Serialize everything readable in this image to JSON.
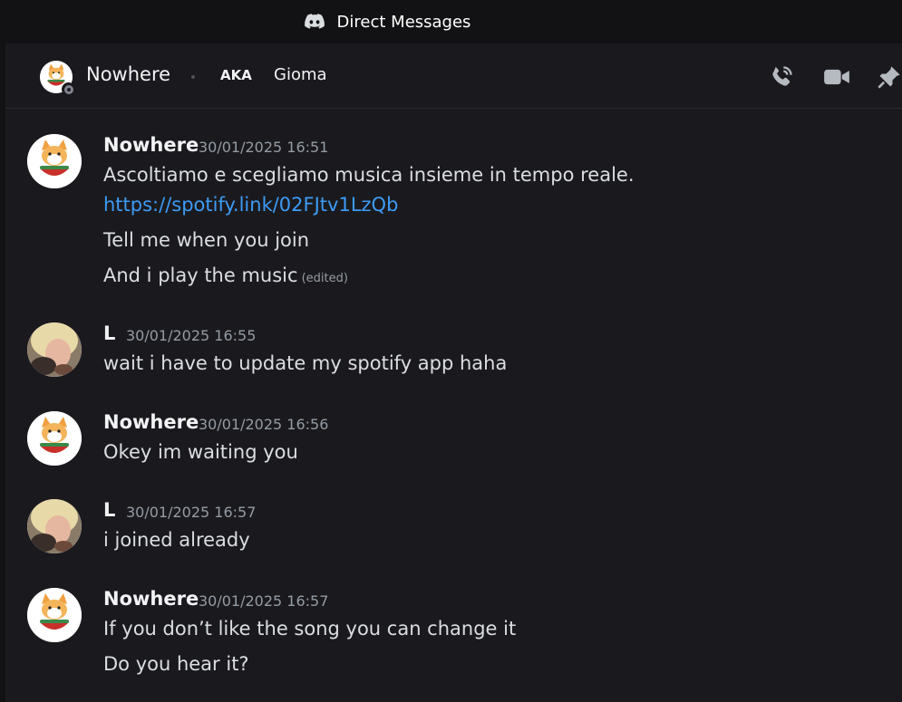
{
  "window": {
    "title": "Direct Messages"
  },
  "header": {
    "name": "Nowhere",
    "aka_label": "AKA",
    "alias": "Gioma",
    "icons": [
      "call-icon",
      "video-icon",
      "pin-icon"
    ]
  },
  "messages": [
    {
      "author": "Nowhere",
      "timestamp": "30/01/2025 16:51",
      "lines": [
        "Ascoltiamo e scegliamo musica insieme in tempo reale.",
        "https://spotify.link/02FJtv1LzQb",
        "Tell me when you join",
        "And i play the music"
      ],
      "edited_label": "(edited)"
    },
    {
      "author": "L",
      "timestamp": "30/01/2025 16:55",
      "lines": [
        "wait i have to update my spotify app haha"
      ]
    },
    {
      "author": "Nowhere",
      "timestamp": "30/01/2025 16:56",
      "lines": [
        "Okey im waiting you"
      ]
    },
    {
      "author": "L",
      "timestamp": "30/01/2025 16:57",
      "lines": [
        "i joined already"
      ]
    },
    {
      "author": "Nowhere",
      "timestamp": "30/01/2025 16:57",
      "lines": [
        "If you don’t like the song you can change it",
        "Do you hear it?"
      ]
    }
  ],
  "colors": {
    "background": "#1a1a1e",
    "titlebar": "#121214",
    "link": "#3d9bf5",
    "muted": "#949ba4",
    "text": "#dbdee1"
  }
}
